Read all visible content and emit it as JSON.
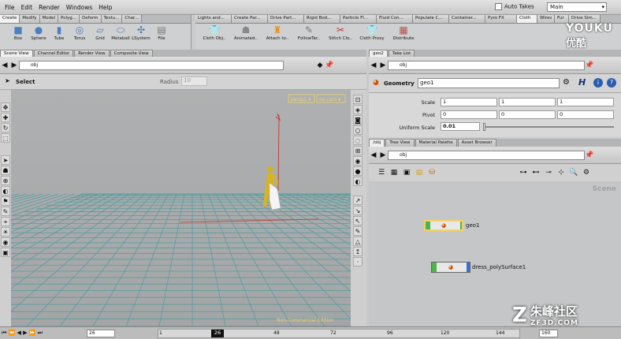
{
  "menubar": {
    "items": [
      "File",
      "Edit",
      "Render",
      "Windows",
      "Help"
    ],
    "auto_takes": "Auto Takes",
    "desktop": "Main"
  },
  "shelf_left": {
    "tabs": [
      "Create",
      "Modify",
      "Model",
      "Polyg...",
      "Deform",
      "Textu...",
      "Char..."
    ],
    "tools": [
      {
        "label": "Box",
        "icon": "box-icon"
      },
      {
        "label": "Sphere",
        "icon": "sphere-icon"
      },
      {
        "label": "Tube",
        "icon": "tube-icon"
      },
      {
        "label": "Torus",
        "icon": "torus-icon"
      },
      {
        "label": "Grid",
        "icon": "grid-icon"
      },
      {
        "label": "Metaball",
        "icon": "metaball-icon"
      },
      {
        "label": "LSystem",
        "icon": "lsystem-icon"
      },
      {
        "label": "File",
        "icon": "file-icon"
      }
    ]
  },
  "shelf_right": {
    "tabs": [
      "Lights and...",
      "Create Par...",
      "Drive Part...",
      "Rigid Bod...",
      "Particle Fl...",
      "Fluid Con...",
      "Populate C...",
      "Container...",
      "Pyro FX",
      "Cloth",
      "Wires",
      "Fur",
      "Drive Sim..."
    ],
    "tools": [
      {
        "label": "Cloth Obj..",
        "icon": "cloth-object-icon"
      },
      {
        "label": "Animated..",
        "icon": "animated-icon"
      },
      {
        "label": "Attach to..",
        "icon": "attach-icon"
      },
      {
        "label": "FollowTar..",
        "icon": "follow-target-icon"
      },
      {
        "label": "Stitch Clo..",
        "icon": "stitch-cloth-icon"
      },
      {
        "label": "Cloth Proxy",
        "icon": "cloth-proxy-icon"
      },
      {
        "label": "Distribute",
        "icon": "distribute-icon"
      }
    ]
  },
  "left_pane": {
    "tabs": [
      "Scene View",
      "Channel Editor",
      "Render View",
      "Composite View"
    ],
    "path": "obj",
    "tool_label": "Select",
    "radius_label": "Radius",
    "radius_value": "10",
    "camera": "persp1 ▾",
    "camera2": "no cam ▾",
    "watermark": "Non-Commercial Edition"
  },
  "params": {
    "tabs": [
      "geo2",
      "Take List"
    ],
    "path": "obj",
    "type_label": "Geometry",
    "node_name": "geo1",
    "h_label": "H",
    "rows": [
      {
        "label": "Scale",
        "values": [
          "1",
          "1",
          "1"
        ]
      },
      {
        "label": "Pivot",
        "values": [
          "0",
          "0",
          "0"
        ]
      },
      {
        "label": "Uniform Scale",
        "values": [
          "0.01"
        ]
      }
    ]
  },
  "network": {
    "tabs": [
      "/obj",
      "Tree View",
      "Material Palette",
      "Asset Browser"
    ],
    "path": "obj",
    "scene_label": "Scene",
    "nodes": [
      {
        "name": "geo1"
      },
      {
        "name": "dress_polySurface1"
      }
    ]
  },
  "timeline": {
    "frame": "26",
    "ticks": [
      "1",
      "24",
      "48",
      "72",
      "96",
      "120",
      "144"
    ],
    "current": "26",
    "end": "160"
  },
  "overlay": {
    "youku": "YOUKU",
    "youku_cn": "优酷",
    "site": "朱峰社区",
    "site_url": "ZF3D.COM"
  },
  "colors": {
    "accent": "#f3d36a",
    "grid": "#4f9b9e",
    "node_green": "#4bb54b",
    "node_blue": "#3a6fd6"
  }
}
